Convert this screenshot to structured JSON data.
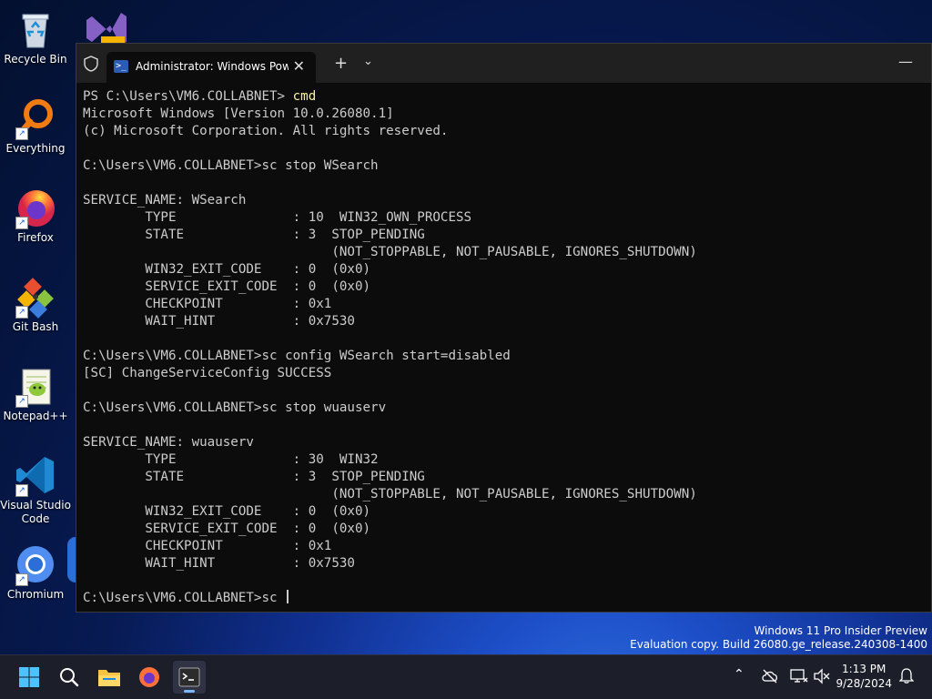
{
  "desktop": {
    "icons": [
      {
        "label": "Recycle Bin",
        "icon": "recycle-bin-icon"
      },
      {
        "label": "Everything",
        "icon": "everything-search-icon"
      },
      {
        "label": "Firefox",
        "icon": "firefox-icon"
      },
      {
        "label": "Git Bash",
        "icon": "git-bash-icon"
      },
      {
        "label": "Notepad++",
        "icon": "notepad-plus-plus-icon"
      },
      {
        "label": "Visual Studio Code",
        "icon": "vscode-icon"
      },
      {
        "label": "Chromium",
        "icon": "chromium-icon"
      }
    ]
  },
  "terminal": {
    "tab_title": "Administrator: Windows PowerShell",
    "new_tab": "+",
    "tab_menu": "⌄",
    "close_tab": "✕",
    "minimize": "—",
    "lines": [
      {
        "prompt": "PS C:\\Users\\VM6.COLLABNET> ",
        "cmd": "cmd"
      },
      {
        "text": "Microsoft Windows [Version 10.0.26080.1]"
      },
      {
        "text": "(c) Microsoft Corporation. All rights reserved."
      },
      {
        "text": ""
      },
      {
        "text": "C:\\Users\\VM6.COLLABNET>sc stop WSearch"
      },
      {
        "text": ""
      },
      {
        "text": "SERVICE_NAME: WSearch"
      },
      {
        "text": "        TYPE               : 10  WIN32_OWN_PROCESS"
      },
      {
        "text": "        STATE              : 3  STOP_PENDING"
      },
      {
        "text": "                                (NOT_STOPPABLE, NOT_PAUSABLE, IGNORES_SHUTDOWN)"
      },
      {
        "text": "        WIN32_EXIT_CODE    : 0  (0x0)"
      },
      {
        "text": "        SERVICE_EXIT_CODE  : 0  (0x0)"
      },
      {
        "text": "        CHECKPOINT         : 0x1"
      },
      {
        "text": "        WAIT_HINT          : 0x7530"
      },
      {
        "text": ""
      },
      {
        "text": "C:\\Users\\VM6.COLLABNET>sc config WSearch start=disabled"
      },
      {
        "text": "[SC] ChangeServiceConfig SUCCESS"
      },
      {
        "text": ""
      },
      {
        "text": "C:\\Users\\VM6.COLLABNET>sc stop wuauserv"
      },
      {
        "text": ""
      },
      {
        "text": "SERVICE_NAME: wuauserv"
      },
      {
        "text": "        TYPE               : 30  WIN32"
      },
      {
        "text": "        STATE              : 3  STOP_PENDING"
      },
      {
        "text": "                                (NOT_STOPPABLE, NOT_PAUSABLE, IGNORES_SHUTDOWN)"
      },
      {
        "text": "        WIN32_EXIT_CODE    : 0  (0x0)"
      },
      {
        "text": "        SERVICE_EXIT_CODE  : 0  (0x0)"
      },
      {
        "text": "        CHECKPOINT         : 0x1"
      },
      {
        "text": "        WAIT_HINT          : 0x7530"
      },
      {
        "text": ""
      },
      {
        "text": "C:\\Users\\VM6.COLLABNET>sc ",
        "cursor": true
      }
    ]
  },
  "watermark": {
    "line1": "Windows 11 Pro Insider Preview",
    "line2": "Evaluation copy. Build 26080.ge_release.240308-1400"
  },
  "taskbar": {
    "items": [
      "start-icon",
      "search-icon",
      "file-explorer-icon",
      "firefox-icon",
      "terminal-icon"
    ],
    "tray_chevron": "⌃",
    "time": "1:13 PM",
    "date": "9/28/2024"
  }
}
